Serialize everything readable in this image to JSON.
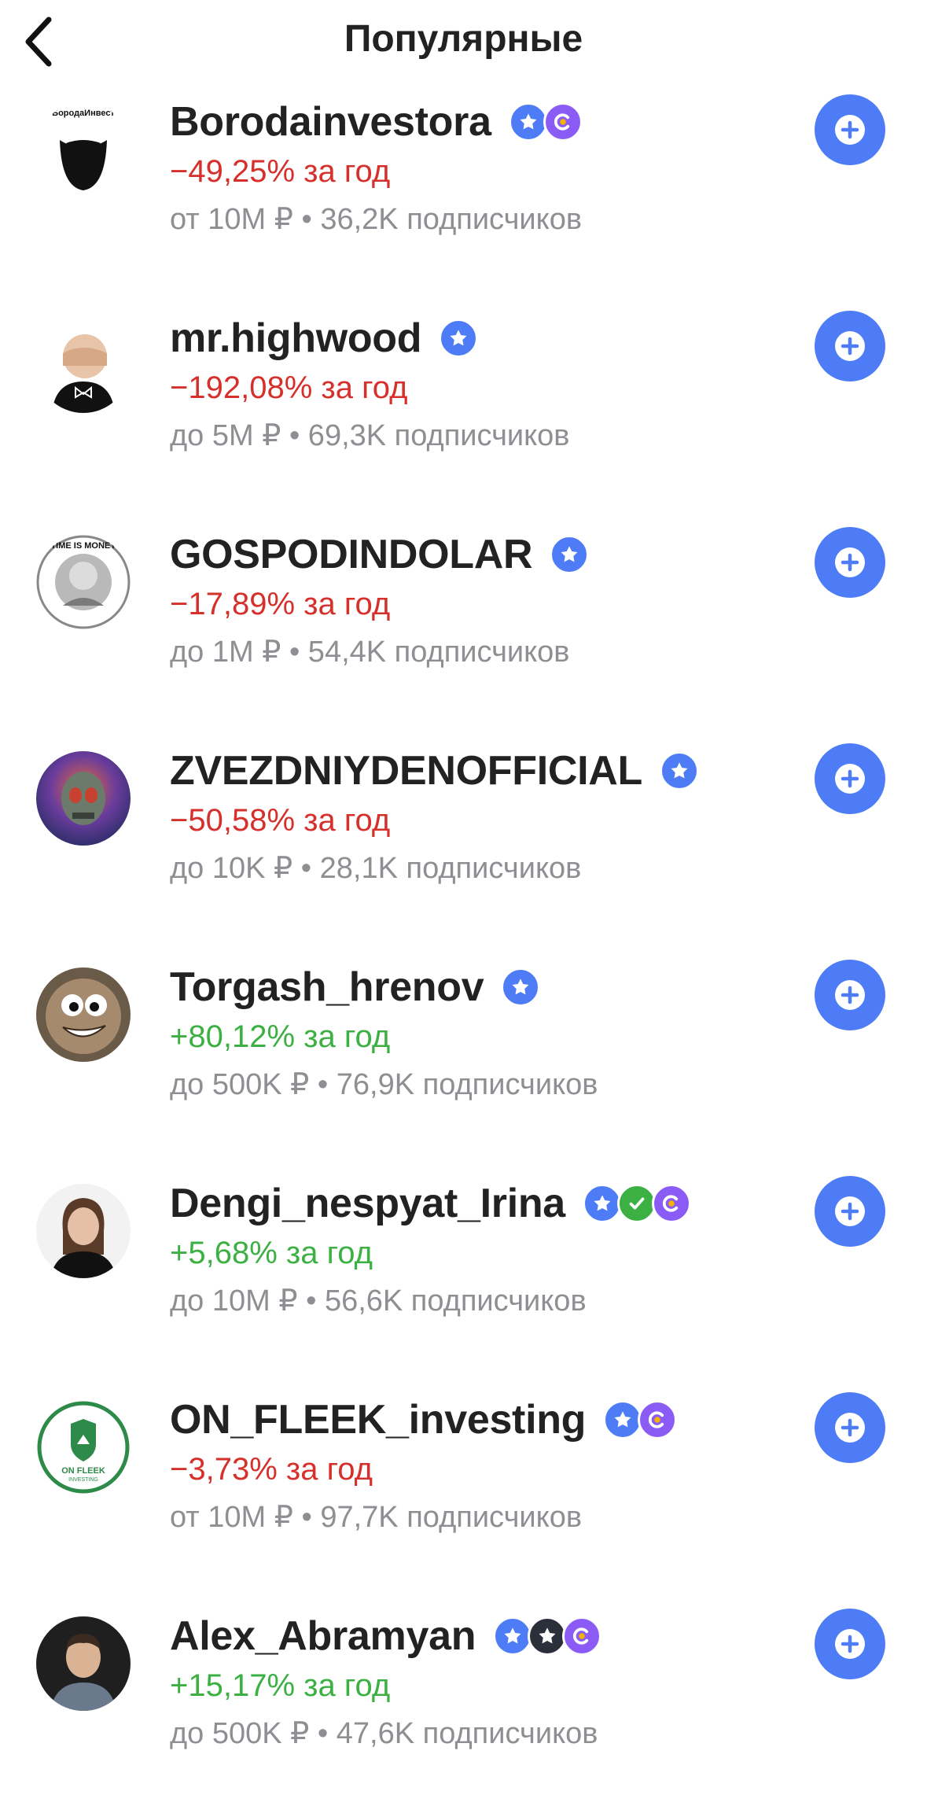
{
  "header": {
    "title": "Популярные"
  },
  "items": [
    {
      "name": "Borodainvestora",
      "return": "−49,25% за год",
      "trend": "neg",
      "meta": "от 10M ₽ • 36,2K подписчиков",
      "badges": [
        "star",
        "c"
      ],
      "avatar_text": "БородаИнвест",
      "avatar_bg": "#ffffff"
    },
    {
      "name": "mr.highwood",
      "return": "−192,08% за год",
      "trend": "neg",
      "meta": "до 5M ₽ • 69,3K подписчиков",
      "badges": [
        "star"
      ],
      "avatar_bg": "#ffffff"
    },
    {
      "name": "GOSPODINDOLAR",
      "return": "−17,89% за год",
      "trend": "neg",
      "meta": "до 1M ₽ • 54,4K подписчиков",
      "badges": [
        "star"
      ],
      "avatar_text": "TIME IS MONEY",
      "avatar_bg": "#ffffff"
    },
    {
      "name": "ZVEZDNIYDENOFFICIAL",
      "return": "−50,58% за год",
      "trend": "neg",
      "meta": "до 10K ₽ • 28,1K подписчиков",
      "badges": [
        "star"
      ],
      "avatar_bg": "#1b2a5a"
    },
    {
      "name": "Torgash_hrenov",
      "return": "+80,12% за год",
      "trend": "pos",
      "meta": "до 500K ₽ • 76,9K подписчиков",
      "badges": [
        "star"
      ],
      "avatar_bg": "#5a4b3a"
    },
    {
      "name": "Dengi_nespyat_Irina",
      "return": "+5,68% за год",
      "trend": "pos",
      "meta": "до 10M ₽ • 56,6K подписчиков",
      "badges": [
        "star",
        "check",
        "c"
      ],
      "avatar_bg": "#f2f2f2"
    },
    {
      "name": "ON_FLEEK_investing",
      "return": "−3,73% за год",
      "trend": "neg",
      "meta": "от 10M ₽ • 97,7K подписчиков",
      "badges": [
        "star",
        "c"
      ],
      "avatar_text": "ON FLEEK",
      "avatar_sub": "INVESTING",
      "avatar_bg": "#ffffff"
    },
    {
      "name": "Alex_Abramyan",
      "return": "+15,17% за год",
      "trend": "pos",
      "meta": "до 500K ₽ • 47,6K подписчиков",
      "badges": [
        "star",
        "star-dark",
        "c"
      ],
      "avatar_bg": "#1f1f1f"
    }
  ],
  "colors": {
    "accent": "#4d7cf6",
    "negative": "#d6302c",
    "positive": "#3cb043",
    "muted": "#8e8e93",
    "badge_star": "#4d7cf6",
    "badge_c": "#8a5cf5",
    "badge_check": "#3cb043",
    "badge_star_dark": "#2a2f3a"
  },
  "icons": {
    "back": "chevron-left-icon",
    "follow": "plus-circle-icon",
    "star": "star-badge-icon",
    "c": "c-badge-icon",
    "check": "verified-check-icon"
  }
}
